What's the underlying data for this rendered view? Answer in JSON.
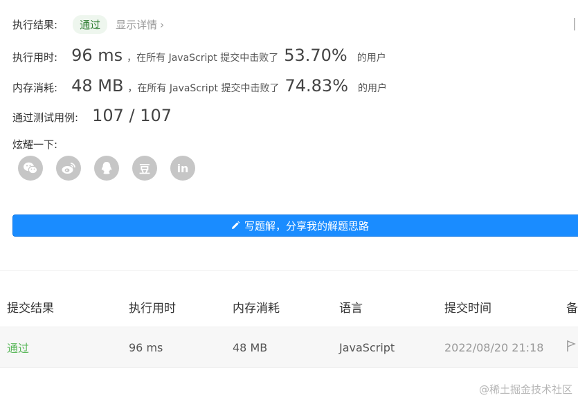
{
  "result": {
    "label": "执行结果:",
    "status": "通过",
    "details_link": "显示详情",
    "details_chevron": "›"
  },
  "runtime": {
    "label": "执行用时:",
    "value": "96 ms",
    "text_before": "，在所有 JavaScript 提交中击败了",
    "percent": "53.70%",
    "text_after": "的用户"
  },
  "memory": {
    "label": "内存消耗:",
    "value": "48 MB",
    "text_before": "，在所有 JavaScript 提交中击败了",
    "percent": "74.83%",
    "text_after": "的用户"
  },
  "tests": {
    "label": "通过测试用例:",
    "value": "107 / 107"
  },
  "share": {
    "label": "炫耀一下:",
    "icons": [
      "wechat-icon",
      "weibo-icon",
      "qq-icon",
      "douban-icon",
      "linkedin-icon"
    ],
    "douban_glyph": "豆",
    "linkedin_glyph": "in"
  },
  "solution_button": {
    "label": "写题解，分享我的解题思路",
    "color": "#1a8cff"
  },
  "table": {
    "headers": [
      "提交结果",
      "执行用时",
      "内存消耗",
      "语言",
      "提交时间",
      "备"
    ],
    "rows": [
      {
        "result": "通过",
        "runtime": "96 ms",
        "memory": "48 MB",
        "language": "JavaScript",
        "time": "2022/08/20 21:18"
      }
    ]
  },
  "watermark": "@稀土掘金技术社区",
  "colors": {
    "pass_green": "#5cb85c",
    "primary_blue": "#1a8cff"
  }
}
